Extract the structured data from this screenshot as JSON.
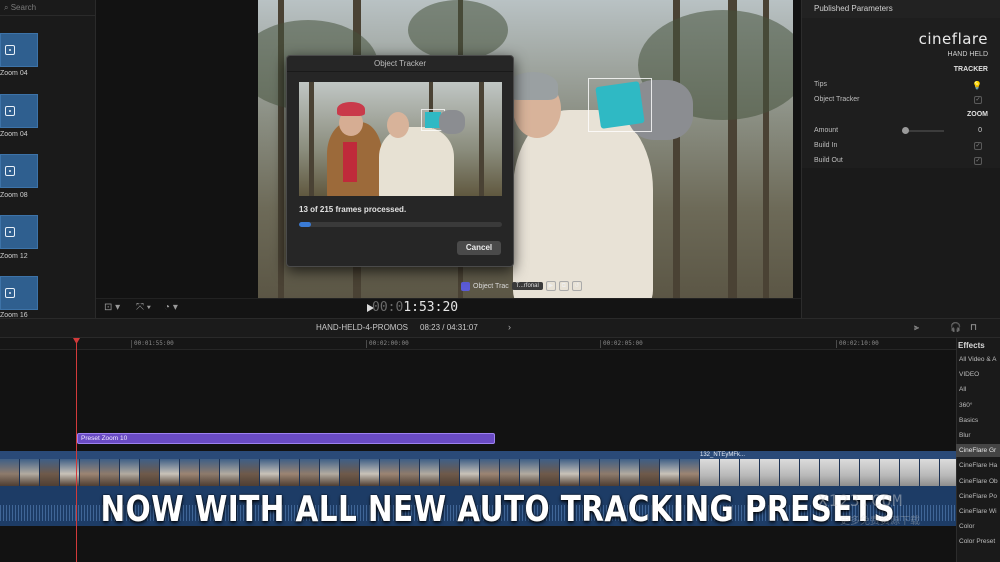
{
  "browser": {
    "search_placeholder": "Search",
    "clips": [
      {
        "label": "Zoom 04"
      },
      {
        "label": "Zoom 04"
      },
      {
        "label": "Zoom 08"
      },
      {
        "label": "Zoom 12"
      },
      {
        "label": "Zoom 16"
      }
    ]
  },
  "viewer": {
    "timecode_dim": "00:0",
    "timecode": "1:53:20",
    "object_tracker_label": "Object Trac",
    "tracker_select": "T...rfonal"
  },
  "dialog": {
    "title": "Object Tracker",
    "status": "13 of 215 frames processed.",
    "progress": 0.06,
    "cancel_label": "Cancel"
  },
  "inspector": {
    "header": "Published Parameters",
    "brand": "cineflare",
    "product": "HAND HELD",
    "section_tracker": "TRACKER",
    "section_zoom": "ZOOM",
    "params": {
      "tips": "Tips",
      "object_tracker": "Object Tracker",
      "amount": "Amount",
      "amount_value": "0",
      "build_in": "Build In",
      "build_out": "Build Out"
    }
  },
  "timeline": {
    "project_name": "HAND-HELD-4-PROMOS",
    "duration": "08:23 / 04:31:07",
    "ruler": [
      "00:01:55:00",
      "00:02:00:00",
      "00:02:05:00",
      "00:02:10:00"
    ],
    "title_clip": "Preset Zoom 10",
    "clip2_name": "132_NTEyMFk..."
  },
  "effects": {
    "title": "Effects",
    "items": [
      "All Video & A",
      "VIDEO",
      "All",
      "360°",
      "Basics",
      "Blur",
      "CineFlare Gr",
      "CineFlare Ha",
      "CineFlare Ob",
      "CineFlare Po",
      "CineFlare Wi",
      "Color",
      "Color Preset"
    ]
  },
  "caption": "NOW WITH ALL NEW AUTO TRACKING PRESETS",
  "watermark": "X123.COM",
  "watermark2": "更多免费资源下载"
}
